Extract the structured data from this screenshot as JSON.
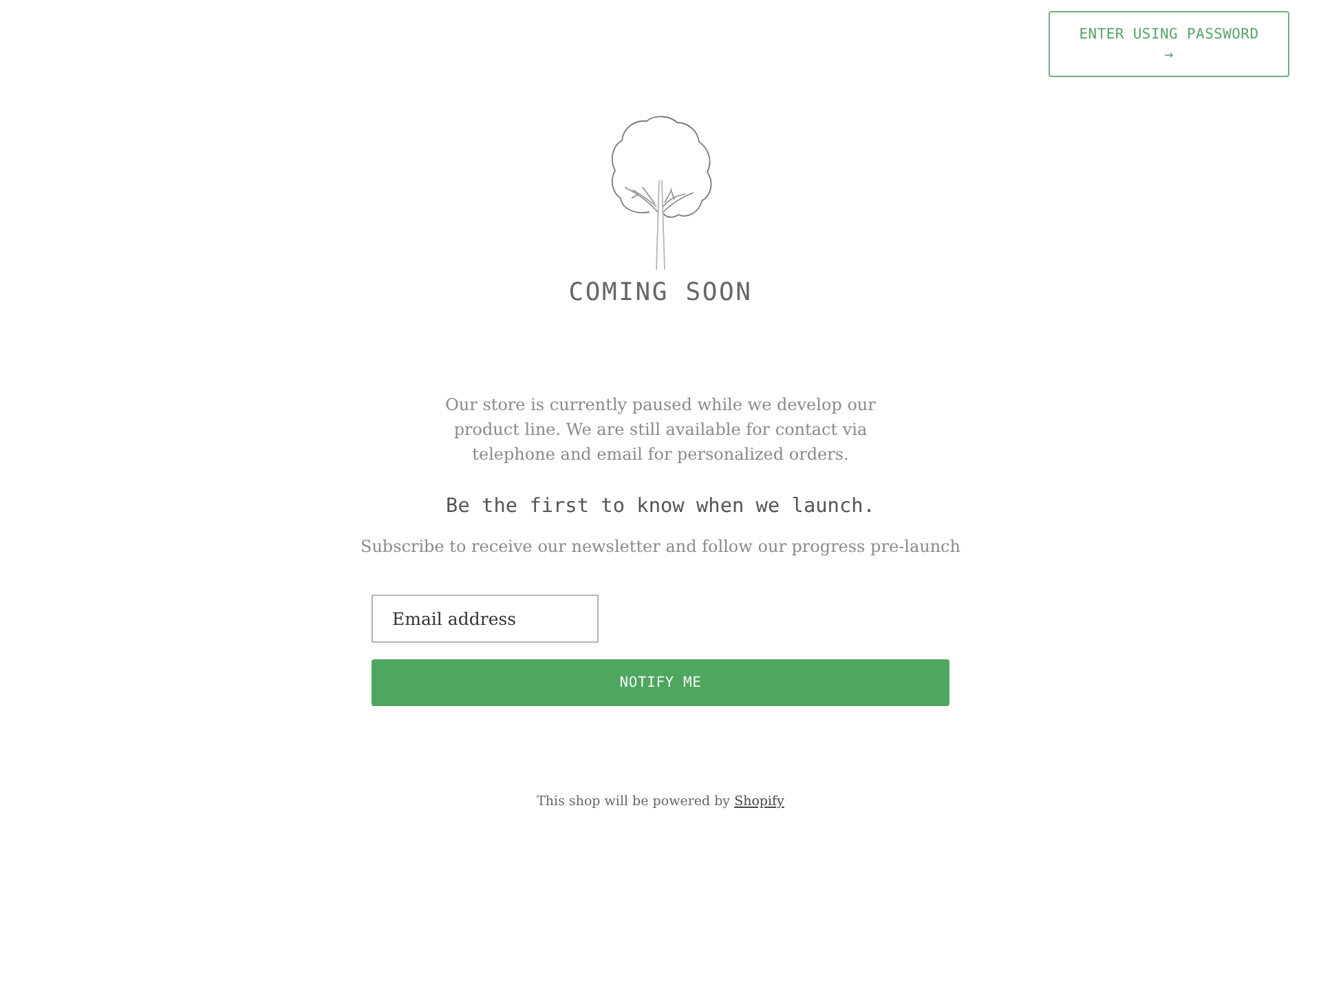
{
  "header": {
    "password_button": {
      "label": "ENTER USING PASSWORD",
      "arrow": "→"
    }
  },
  "hero": {
    "title": "COMING SOON"
  },
  "content": {
    "message": "Our store is currently paused while we develop our product line. We are still available for contact via telephone and email for personalized orders.",
    "heading": "Be the first to know when we launch.",
    "subtext": "Subscribe to receive our newsletter and follow our progress pre-launch"
  },
  "signup_form": {
    "email_field": {
      "placeholder": "Email address"
    },
    "submit_button": {
      "label": "NOTIFY ME"
    }
  },
  "footer": {
    "text": "This shop will be powered by",
    "link": "Shopify"
  }
}
